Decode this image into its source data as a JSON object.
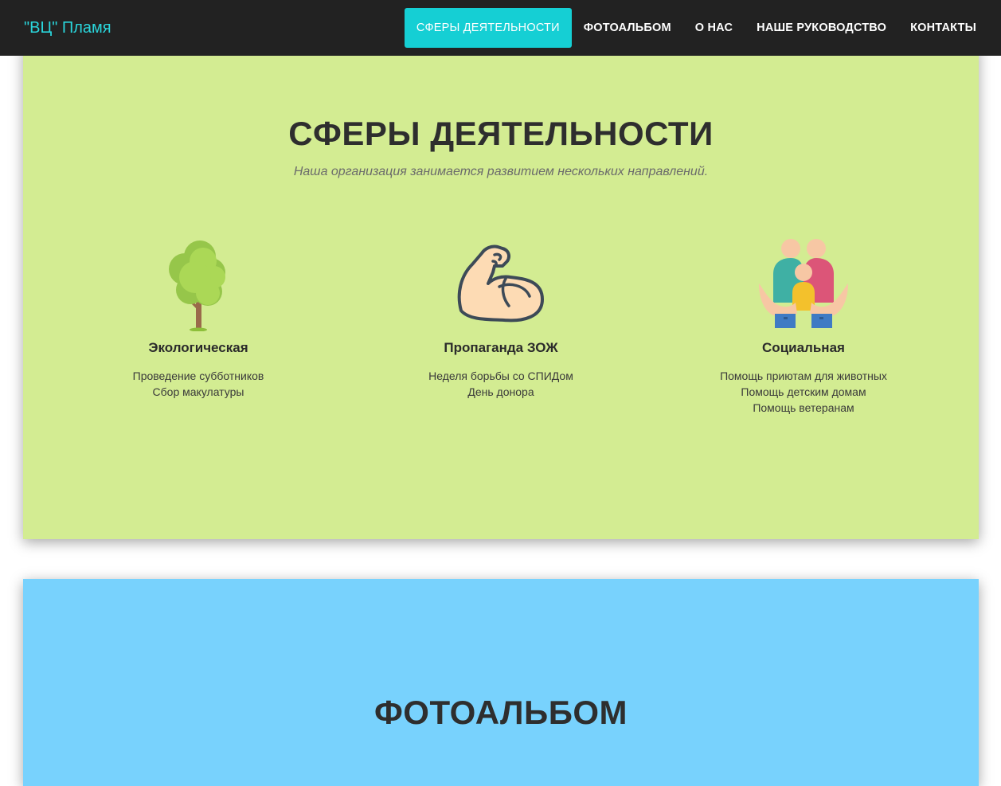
{
  "navbar": {
    "brand": "\"ВЦ\" Пламя",
    "items": [
      {
        "label": "Сферы деятельности",
        "active": true
      },
      {
        "label": "Фотоальбом",
        "active": false
      },
      {
        "label": "О нас",
        "active": false
      },
      {
        "label": "Наше руководство",
        "active": false
      },
      {
        "label": "Контакты",
        "active": false
      }
    ]
  },
  "activities": {
    "title": "СФЕРЫ ДЕЯТЕЛЬНОСТИ",
    "subtitle": "Наша организация занимается развитием нескольких направлений.",
    "features": [
      {
        "icon": "tree-icon",
        "title": "Экологическая",
        "lines": [
          "Проведение субботников",
          "Сбор макулатуры"
        ]
      },
      {
        "icon": "flexed-bicep-icon",
        "title": "Пропаганда ЗОЖ",
        "lines": [
          "Неделя борьбы со СПИДом",
          "День донора"
        ]
      },
      {
        "icon": "family-in-hands-icon",
        "title": "Социальная",
        "lines": [
          "Помощь приютам для животных",
          "Помощь детским домам",
          "Помощь ветеранам"
        ]
      }
    ]
  },
  "photo_album": {
    "title": "ФОТОАЛЬБОМ"
  },
  "colors": {
    "navbar_bg": "#222222",
    "brand": "#2ad6dc",
    "nav_active_bg": "#15cfd4",
    "section_green": "#d3ec92",
    "section_blue": "#78d2fd",
    "heading": "#2e2e2e"
  }
}
